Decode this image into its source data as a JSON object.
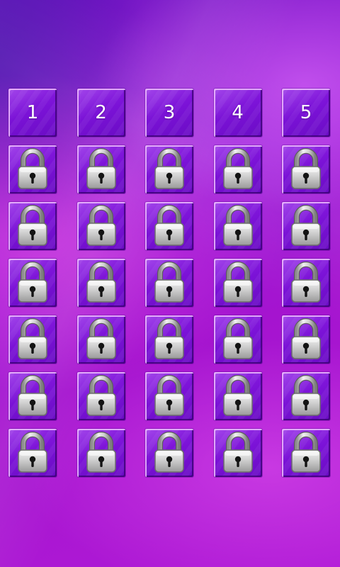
{
  "screen": "level-select",
  "theme": {
    "background": "#9a1ed9",
    "tile": "#7a12d6",
    "tile_text": "#ffffff",
    "lock_body": "#c9c9c9"
  },
  "levels": [
    {
      "label": "1",
      "locked": false
    },
    {
      "label": "2",
      "locked": false
    },
    {
      "label": "3",
      "locked": false
    },
    {
      "label": "4",
      "locked": false
    },
    {
      "label": "5",
      "locked": false
    },
    {
      "label": "",
      "locked": true
    },
    {
      "label": "",
      "locked": true
    },
    {
      "label": "",
      "locked": true
    },
    {
      "label": "",
      "locked": true
    },
    {
      "label": "",
      "locked": true
    },
    {
      "label": "",
      "locked": true
    },
    {
      "label": "",
      "locked": true
    },
    {
      "label": "",
      "locked": true
    },
    {
      "label": "",
      "locked": true
    },
    {
      "label": "",
      "locked": true
    },
    {
      "label": "",
      "locked": true
    },
    {
      "label": "",
      "locked": true
    },
    {
      "label": "",
      "locked": true
    },
    {
      "label": "",
      "locked": true
    },
    {
      "label": "",
      "locked": true
    },
    {
      "label": "",
      "locked": true
    },
    {
      "label": "",
      "locked": true
    },
    {
      "label": "",
      "locked": true
    },
    {
      "label": "",
      "locked": true
    },
    {
      "label": "",
      "locked": true
    },
    {
      "label": "",
      "locked": true
    },
    {
      "label": "",
      "locked": true
    },
    {
      "label": "",
      "locked": true
    },
    {
      "label": "",
      "locked": true
    },
    {
      "label": "",
      "locked": true
    },
    {
      "label": "",
      "locked": true
    },
    {
      "label": "",
      "locked": true
    },
    {
      "label": "",
      "locked": true
    },
    {
      "label": "",
      "locked": true
    },
    {
      "label": "",
      "locked": true
    }
  ],
  "icons": {
    "locked": "padlock-icon"
  }
}
